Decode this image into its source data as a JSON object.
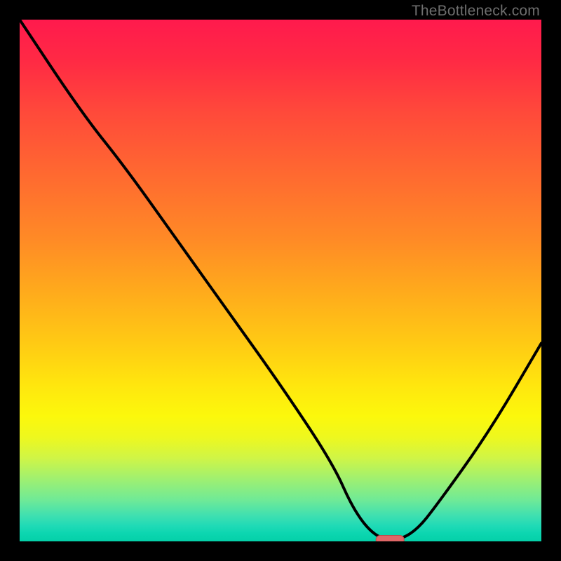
{
  "watermark": {
    "text": "TheBottleneck.com"
  },
  "colors": {
    "frame_bg": "#000000",
    "curve": "#000000",
    "marker_fill": "#e06767",
    "marker_stroke": "#b84d4d",
    "gradient_top": "#ff1a4d",
    "gradient_mid": "#ffe60e",
    "gradient_bottom": "#04d0a8"
  },
  "chart_data": {
    "type": "line",
    "title": "",
    "xlabel": "",
    "ylabel": "",
    "xlim": [
      0,
      100
    ],
    "ylim": [
      0,
      100
    ],
    "series": [
      {
        "name": "bottleneck-curve",
        "x": [
          0,
          12,
          20,
          30,
          40,
          50,
          60,
          64,
          68,
          72,
          76,
          80,
          90,
          100
        ],
        "values": [
          100,
          82,
          72,
          58,
          44,
          30,
          15,
          6,
          1,
          0,
          2,
          7,
          21,
          38
        ]
      }
    ],
    "marker": {
      "x": 71,
      "y": 0,
      "shape": "pill"
    },
    "grid": false,
    "legend": false
  }
}
